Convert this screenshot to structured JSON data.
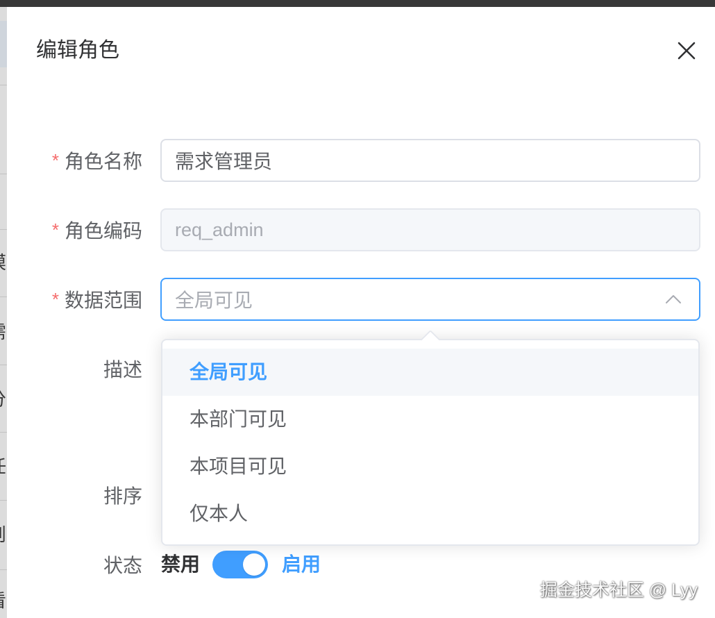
{
  "background_page": {
    "fragments": [
      "模",
      "需",
      "分",
      "任",
      "则",
      "看"
    ]
  },
  "dialog": {
    "title": "编辑角色",
    "close_icon": "close-icon"
  },
  "form": {
    "required_mark": "*",
    "role_name": {
      "label": "角色名称",
      "value": "需求管理员",
      "required": true
    },
    "role_code": {
      "label": "角色编码",
      "value": "req_admin",
      "required": true,
      "disabled": true
    },
    "data_scope": {
      "label": "数据范围",
      "placeholder": "全局可见",
      "required": true,
      "open": true,
      "icon": "chevron-up-icon"
    },
    "description": {
      "label": "描述"
    },
    "sort": {
      "label": "排序"
    },
    "status": {
      "label": "状态",
      "inactive_text": "禁用",
      "active_text": "启用",
      "checked": true
    }
  },
  "data_scope_dropdown": {
    "options": [
      {
        "label": "全局可见",
        "selected": true
      },
      {
        "label": "本部门可见",
        "selected": false
      },
      {
        "label": "本项目可见",
        "selected": false
      },
      {
        "label": "仅本人",
        "selected": false
      }
    ]
  },
  "watermark": "掘金技术社区 @ Lyy",
  "colors": {
    "primary": "#409eff",
    "required": "#f56c6c",
    "text_primary": "#303133",
    "text_regular": "#606266",
    "placeholder": "#a8abb2",
    "border": "#dcdfe6",
    "disabled_bg": "#f5f7fa"
  }
}
